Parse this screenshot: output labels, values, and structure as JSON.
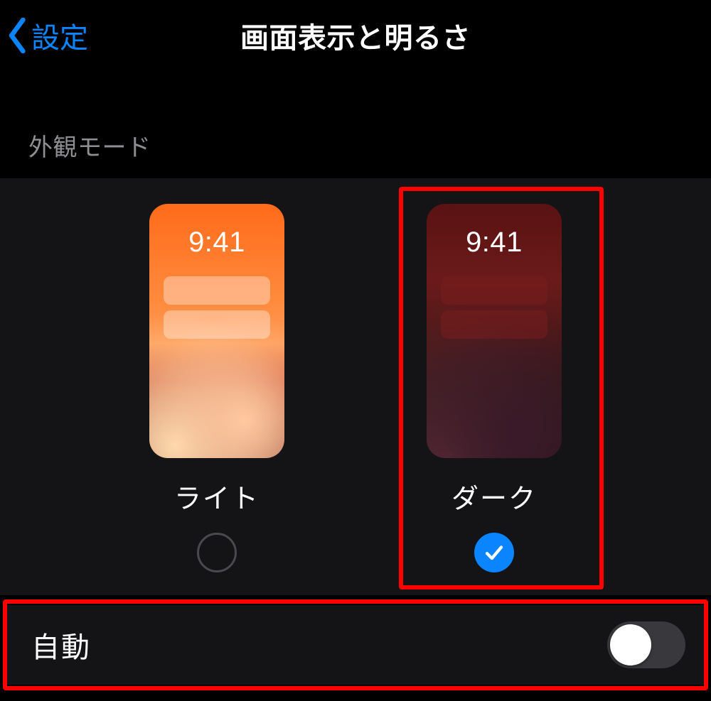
{
  "nav": {
    "back_label": "設定",
    "title": "画面表示と明るさ"
  },
  "appearance": {
    "section_header": "外観モード",
    "preview_time": "9:41",
    "options": {
      "light": {
        "label": "ライト",
        "selected": false
      },
      "dark": {
        "label": "ダーク",
        "selected": true
      }
    }
  },
  "auto": {
    "label": "自動",
    "enabled": false
  },
  "colors": {
    "accent": "#0a84ff",
    "highlight": "#ff0000"
  }
}
